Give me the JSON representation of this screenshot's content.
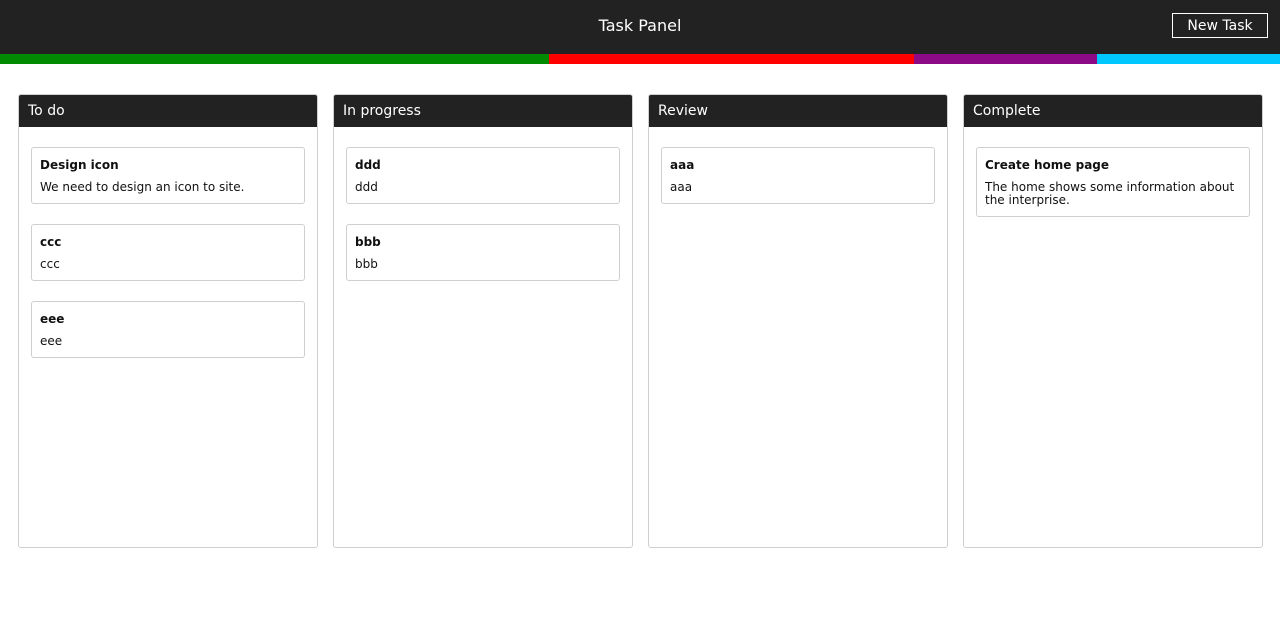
{
  "header": {
    "title": "Task Panel",
    "new_task_label": "New Task"
  },
  "strip": [
    {
      "name": "todo",
      "color": "#038a03",
      "fraction": 0.4286
    },
    {
      "name": "in-progress",
      "color": "#ff0000",
      "fraction": 0.2857
    },
    {
      "name": "review",
      "color": "#8c0a85",
      "fraction": 0.1429
    },
    {
      "name": "complete",
      "color": "#00c8ff",
      "fraction": 0.1428
    }
  ],
  "columns": [
    {
      "title": "To do",
      "cards": [
        {
          "title": "Design icon",
          "description": "We need to design an icon to site."
        },
        {
          "title": "ccc",
          "description": "ccc"
        },
        {
          "title": "eee",
          "description": "eee"
        }
      ]
    },
    {
      "title": "In progress",
      "cards": [
        {
          "title": "ddd",
          "description": "ddd"
        },
        {
          "title": "bbb",
          "description": "bbb"
        }
      ]
    },
    {
      "title": "Review",
      "cards": [
        {
          "title": "aaa",
          "description": "aaa"
        }
      ]
    },
    {
      "title": "Complete",
      "cards": [
        {
          "title": "Create home page",
          "description": "The home shows some information about the interprise."
        }
      ]
    }
  ]
}
